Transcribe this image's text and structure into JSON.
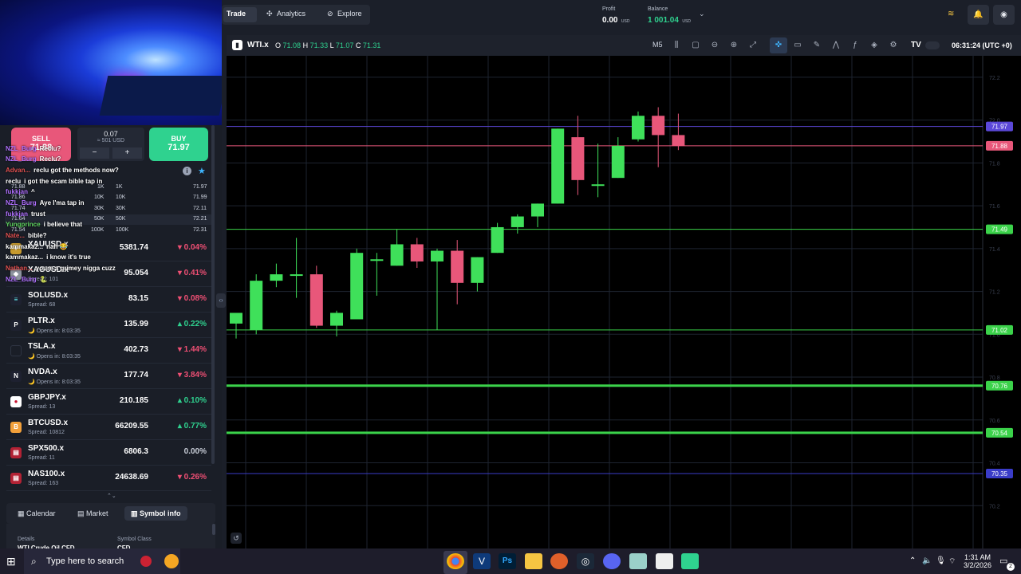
{
  "nav": {
    "tabs": [
      "Trade",
      "Analytics",
      "Explore"
    ]
  },
  "account": {
    "profit_label": "Profit",
    "profit_value": "0.00",
    "profit_unit": "USD",
    "balance_label": "Balance",
    "balance_value": "1 001.04",
    "balance_unit": "USD"
  },
  "trade_panel": {
    "sell_label": "SELL",
    "sell_price": "71.88",
    "buy_label": "BUY",
    "buy_price": "71.97",
    "lot": "0.07",
    "lot_usd": "≈ 501 USD",
    "minus": "−",
    "plus": "+"
  },
  "depth_rows": [
    {
      "sell_price": "71.88",
      "sell_vol": "1K",
      "buy_vol": "1K",
      "buy_price": "71.97"
    },
    {
      "sell_price": "71.86",
      "sell_vol": "10K",
      "buy_vol": "10K",
      "buy_price": "71.99"
    },
    {
      "sell_price": "71.74",
      "sell_vol": "30K",
      "buy_vol": "30K",
      "buy_price": "72.11"
    },
    {
      "sell_price": "71.64",
      "sell_vol": "50K",
      "buy_vol": "50K",
      "buy_price": "72.21"
    },
    {
      "sell_price": "71.54",
      "sell_vol": "100K",
      "buy_vol": "100K",
      "buy_price": "72.31"
    }
  ],
  "chat": [
    {
      "name": "NZL_Burg",
      "text": "Reclu?"
    },
    {
      "name": "NZL_Burg",
      "text": "Reclu?"
    },
    {
      "name": "Advan...",
      "text": "reclu got the methods now?"
    },
    {
      "name": "reclu",
      "text": "i got the scam bible tap in"
    },
    {
      "name": "fukkjan",
      "text": "^"
    },
    {
      "name": "NZL_Burg",
      "text": "Aye I'ma tap in"
    },
    {
      "name": "fukkjan",
      "text": "trust"
    },
    {
      "name": "Yungprince",
      "text": "i believe that"
    },
    {
      "name": "Nate...",
      "text": "bible?"
    },
    {
      "name": "kammakaz...",
      "text": "nah 😂"
    },
    {
      "name": "kammakaz...",
      "text": "i know it's true"
    },
    {
      "name": "Nathan...",
      "text": "youre a grimey nigga cuzz"
    },
    {
      "name": "NZL_Burg",
      "text": "🐍"
    }
  ],
  "symbols": [
    {
      "name": "XAUUSD.x",
      "sub": "",
      "price": "5381.74",
      "change": "0.04%",
      "dir": "neg",
      "icon": "gold-icon",
      "glyph": "✦"
    },
    {
      "name": "XAGUSD.x",
      "sub": "Spread: 101",
      "price": "95.054",
      "change": "0.41%",
      "dir": "neg",
      "icon": "silver-icon",
      "glyph": "◆"
    },
    {
      "name": "SOLUSD.x",
      "sub": "Spread: 68",
      "price": "83.15",
      "change": "0.08%",
      "dir": "neg",
      "icon": "solana-icon",
      "glyph": "≡"
    },
    {
      "name": "PLTR.x",
      "sub": "🌙 Opens in: 8:03:35",
      "price": "135.99",
      "change": "0.22%",
      "dir": "pos",
      "icon": "palantir-icon",
      "glyph": "P"
    },
    {
      "name": "TSLA.x",
      "sub": "🌙 Opens in: 8:03:35",
      "price": "402.73",
      "change": "1.44%",
      "dir": "neg",
      "icon": "tesla-icon",
      "glyph": ""
    },
    {
      "name": "NVDA.x",
      "sub": "🌙 Opens in: 8:03:35",
      "price": "177.74",
      "change": "3.84%",
      "dir": "neg",
      "icon": "nvidia-icon",
      "glyph": "N"
    },
    {
      "name": "GBPJPY.x",
      "sub": "Spread: 13",
      "price": "210.185",
      "change": "0.10%",
      "dir": "pos",
      "icon": "flag-icon",
      "glyph": "●"
    },
    {
      "name": "BTCUSD.x",
      "sub": "Spread: 10812",
      "price": "66209.55",
      "change": "0.77%",
      "dir": "pos",
      "icon": "bitcoin-icon",
      "glyph": "B"
    },
    {
      "name": "SPX500.x",
      "sub": "Spread: 11",
      "price": "6806.3",
      "change": "0.00%",
      "dir": "flat",
      "icon": "us-flag-icon",
      "glyph": "▤"
    },
    {
      "name": "NAS100.x",
      "sub": "Spread: 163",
      "price": "24638.69",
      "change": "0.26%",
      "dir": "neg",
      "icon": "us-flag-icon",
      "glyph": "▤"
    }
  ],
  "bottom_tabs": [
    "Calendar",
    "Market",
    "Symbol info"
  ],
  "details": {
    "details_label": "Details",
    "details_value": "WTI Crude Oil CFD",
    "class_label": "Symbol Class",
    "class_value": "CFD"
  },
  "chart_header": {
    "symbol": "WTI.x",
    "o_label": "O",
    "o": "71.08",
    "h_label": "H",
    "h": "71.33",
    "l_label": "L",
    "l": "71.07",
    "c_label": "C",
    "c": "71.31",
    "timeframe": "M5",
    "clock": "06:31:24 (UTC +0)"
  },
  "chart_data": {
    "type": "candlestick",
    "ylim": [
      70.0,
      72.3
    ],
    "candles": [
      {
        "o": 71.05,
        "h": 71.09,
        "l": 70.98,
        "c": 71.1
      },
      {
        "o": 71.02,
        "h": 71.28,
        "l": 71.0,
        "c": 71.25
      },
      {
        "o": 71.25,
        "h": 71.33,
        "l": 71.22,
        "c": 71.28
      },
      {
        "o": 71.28,
        "h": 71.45,
        "l": 71.17,
        "c": 71.28
      },
      {
        "o": 71.28,
        "h": 71.32,
        "l": 71.03,
        "c": 71.04
      },
      {
        "o": 71.04,
        "h": 71.11,
        "l": 70.99,
        "c": 71.1
      },
      {
        "o": 71.07,
        "h": 71.4,
        "l": 71.07,
        "c": 71.38
      },
      {
        "o": 71.35,
        "h": 71.38,
        "l": 71.18,
        "c": 71.35
      },
      {
        "o": 71.32,
        "h": 71.49,
        "l": 71.32,
        "c": 71.42
      },
      {
        "o": 71.42,
        "h": 71.45,
        "l": 71.31,
        "c": 71.34
      },
      {
        "o": 71.34,
        "h": 71.4,
        "l": 71.02,
        "c": 71.39
      },
      {
        "o": 71.39,
        "h": 71.44,
        "l": 71.14,
        "c": 71.24
      },
      {
        "o": 71.24,
        "h": 71.36,
        "l": 71.2,
        "c": 71.36
      },
      {
        "o": 71.38,
        "h": 71.52,
        "l": 71.38,
        "c": 71.5
      },
      {
        "o": 71.5,
        "h": 71.56,
        "l": 71.47,
        "c": 71.55
      },
      {
        "o": 71.55,
        "h": 71.61,
        "l": 71.5,
        "c": 71.61
      },
      {
        "o": 71.61,
        "h": 71.96,
        "l": 71.61,
        "c": 71.96
      },
      {
        "o": 71.92,
        "h": 72.02,
        "l": 71.65,
        "c": 71.72
      },
      {
        "o": 71.7,
        "h": 71.89,
        "l": 71.64,
        "c": 71.7
      },
      {
        "o": 71.73,
        "h": 71.92,
        "l": 71.73,
        "c": 71.88
      },
      {
        "o": 71.91,
        "h": 72.04,
        "l": 71.9,
        "c": 72.02
      },
      {
        "o": 72.02,
        "h": 72.06,
        "l": 71.78,
        "c": 71.93
      },
      {
        "o": 71.93,
        "h": 72.03,
        "l": 71.86,
        "c": 71.88
      }
    ],
    "levels": [
      {
        "value": 71.97,
        "label": "71.97",
        "color": "#5b48d8"
      },
      {
        "value": 71.88,
        "label": "71.88",
        "color": "#e8577a"
      },
      {
        "value": 71.49,
        "label": "71.49",
        "color": "#3bd24a"
      },
      {
        "value": 71.02,
        "label": "71.02",
        "color": "#3bd24a"
      },
      {
        "value": 70.76,
        "label": "70.76",
        "color": "#3bd24a"
      },
      {
        "value": 70.54,
        "label": "70.54",
        "color": "#3bd24a"
      },
      {
        "value": 70.35,
        "label": "70.35",
        "color": "#3a3cc8"
      }
    ],
    "y_ticks": [
      "72.2",
      "72.0",
      "71.8",
      "71.6",
      "71.4",
      "71.2",
      "71.0",
      "70.8",
      "70.6",
      "70.4",
      "70.2"
    ],
    "bull_color": "#3fe05a",
    "bear_color": "#e8577a"
  },
  "taskbar": {
    "search_placeholder": "Type here to search",
    "time": "1:31 AM",
    "date": "3/2/2026",
    "notif_count": "2"
  },
  "colors": {
    "accent": "#2fd28f",
    "sell": "#e8577a",
    "bg": "#1a1e27"
  }
}
